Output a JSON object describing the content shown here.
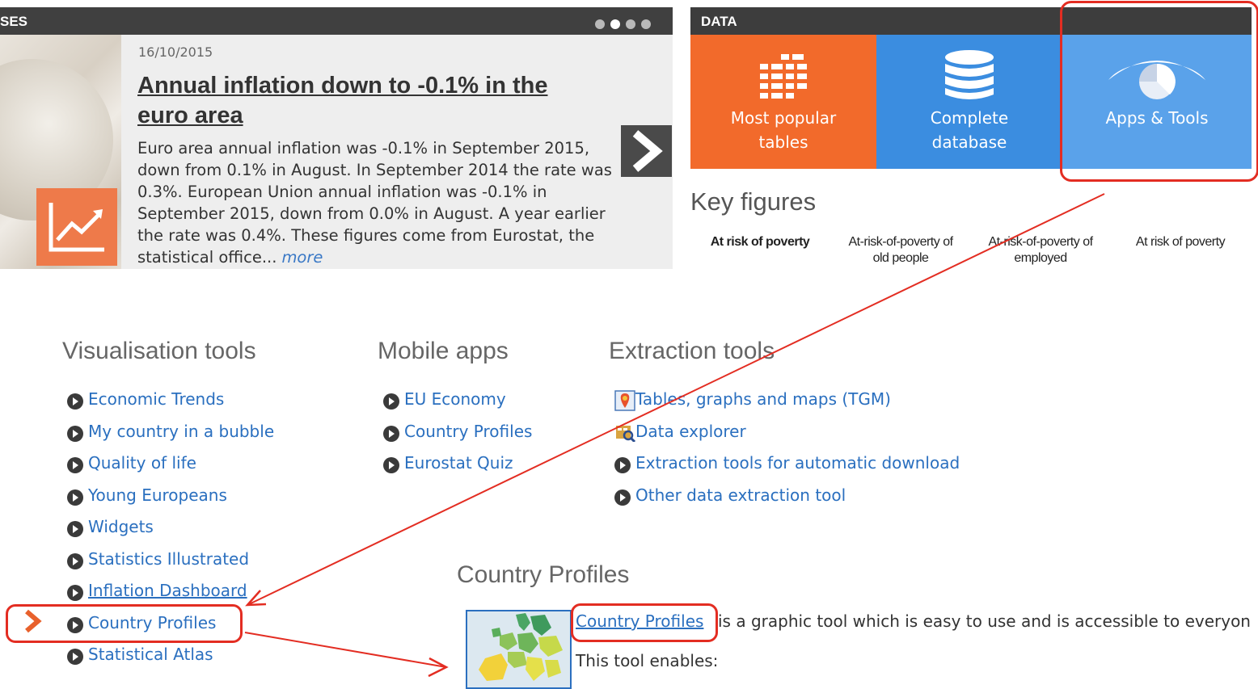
{
  "news": {
    "header_title": "SES",
    "date": "16/10/2015",
    "headline": "Annual inflation down to -0.1% in the euro area",
    "body": "Euro area annual inflation was -0.1% in September 2015, down from 0.1% in August. In September 2014 the rate was 0.3%. European Union annual inflation was -0.1% in September 2015, down from 0.0% in August. A year earlier the rate was 0.4%. These figures come from Eurostat, the statistical office...",
    "more_label": "more",
    "carousel_dots": 4,
    "active_dot": 2
  },
  "data_panel": {
    "header_title": "DATA",
    "tiles": [
      {
        "label_line1": "Most popular",
        "label_line2": "tables",
        "icon": "table-icon",
        "color": "#f26a2b"
      },
      {
        "label_line1": "Complete",
        "label_line2": "database",
        "icon": "database-icon",
        "color": "#3b8de0"
      },
      {
        "label_line1": "Apps & Tools",
        "label_line2": "",
        "icon": "eye-icon",
        "color": "#5aa2ea"
      }
    ]
  },
  "key_figures": {
    "title": "Key figures",
    "items": [
      {
        "line1": "At risk of poverty",
        "line2": ""
      },
      {
        "line1": "At-risk-of-poverty of",
        "line2": "old people"
      },
      {
        "line1": "At-risk-of-poverty of",
        "line2": "employed"
      },
      {
        "line1": "At risk of poverty",
        "line2": ""
      }
    ]
  },
  "visualisation_tools": {
    "title": "Visualisation tools",
    "items": [
      "Economic Trends",
      "My country in a bubble",
      "Quality of life",
      "Young Europeans",
      "Widgets",
      "Statistics Illustrated",
      "Inflation Dashboard",
      "Country Profiles",
      "Statistical Atlas"
    ]
  },
  "mobile_apps": {
    "title": "Mobile apps",
    "items": [
      "EU Economy",
      "Country Profiles",
      "Eurostat Quiz"
    ]
  },
  "extraction_tools": {
    "title": "Extraction tools",
    "items": [
      {
        "label": "Tables, graphs and maps (TGM)",
        "icon": "tgm-icon"
      },
      {
        "label": "Data explorer",
        "icon": "data-explorer-icon"
      },
      {
        "label": "Extraction tools for automatic download",
        "icon": "arrow-circle-icon"
      },
      {
        "label": "Other data extraction tool",
        "icon": "arrow-circle-icon"
      }
    ]
  },
  "country_profiles": {
    "title": "Country Profiles",
    "link_label": "Country Profiles",
    "description": "is a graphic tool which is easy to use and is accessible to everyon",
    "enables": "This tool enables:"
  },
  "colors": {
    "highlight_red": "#e32d22",
    "link_blue": "#2a6fbf",
    "orange": "#f26a2b"
  }
}
